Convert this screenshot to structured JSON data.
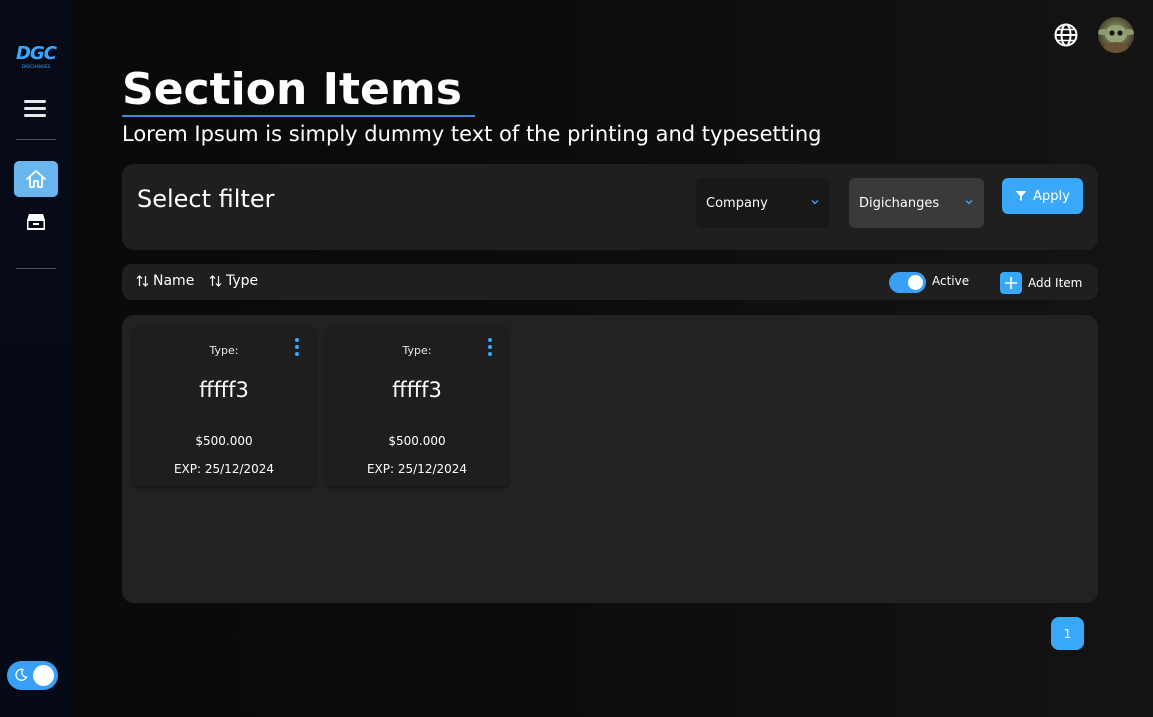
{
  "sidebar": {
    "logo_text": "DGC",
    "logo_subtext": "DIGICHANGES",
    "icons": [
      "menu-icon",
      "home-icon",
      "inbox-icon"
    ],
    "theme_toggle_icon": "moon-icon"
  },
  "header": {
    "title": "Section Items",
    "subtitle": "Lorem Ipsum is simply dummy text of the printing and typesetting"
  },
  "topbar": {
    "icons": [
      "globe-icon",
      "avatar"
    ]
  },
  "filter": {
    "title": "Select filter",
    "company_select": "Company",
    "organization_select": "Digichanges",
    "apply_label": "Apply"
  },
  "toolbar": {
    "sort_name": "Name",
    "sort_type": "Type",
    "active_label": "Active",
    "add_item_label": "Add Item"
  },
  "items": [
    {
      "type_label": "Type:",
      "name": "fffff3",
      "price": "$500.000",
      "exp": "EXP: 25/12/2024"
    },
    {
      "type_label": "Type:",
      "name": "fffff3",
      "price": "$500.000",
      "exp": "EXP: 25/12/2024"
    }
  ],
  "pagination": {
    "current_page": "1"
  },
  "colors": {
    "accent": "#3aa8f8",
    "panel": "#1f1f1f",
    "sidebar": "#060b17",
    "title_underline": "#3f86d8"
  }
}
